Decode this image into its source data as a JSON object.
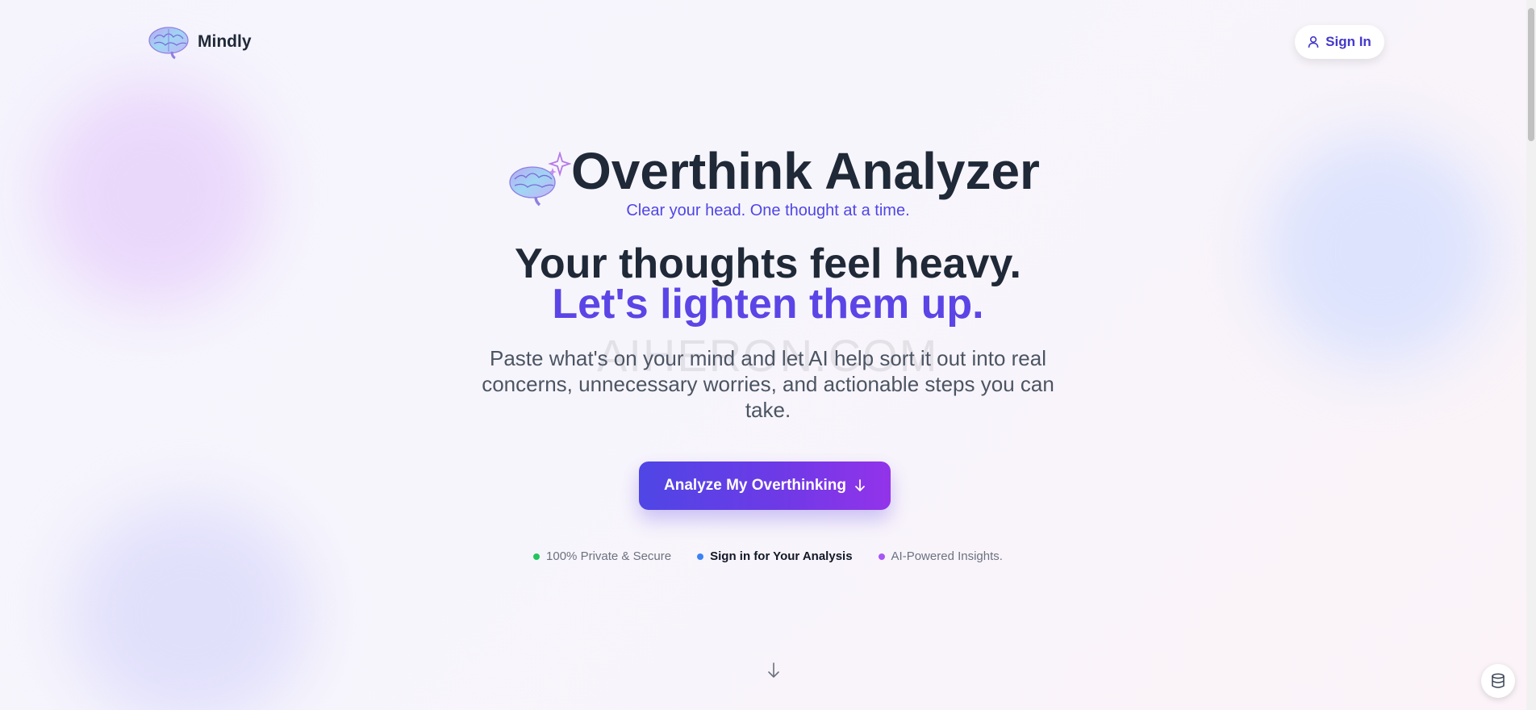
{
  "brand": {
    "name": "Mindly",
    "logo_icon": "brain-icon"
  },
  "header": {
    "signin_label": "Sign In",
    "signin_icon": "user-icon"
  },
  "hero": {
    "title": "Overthink Analyzer",
    "title_icon": "brain-sparkle-icon",
    "tagline": "Clear your head. One thought at a time.",
    "headline_line1": "Your thoughts feel heavy.",
    "headline_line2": "Let's lighten them up.",
    "description": "Paste what's on your mind and let AI help sort it out into real concerns, unnecessary worries, and actionable steps you can take.",
    "cta_label": "Analyze My Overthinking",
    "cta_icon": "arrow-down-icon"
  },
  "watermark": "AIHERON.COM",
  "features": [
    {
      "label": "100% Private & Secure",
      "color": "#22c55e",
      "bold": false
    },
    {
      "label": "Sign in for Your Analysis",
      "color": "#3b82f6",
      "bold": true
    },
    {
      "label": "AI-Powered Insights.",
      "color": "#a855f7",
      "bold": false
    }
  ],
  "colors": {
    "accent": "#4f46e5",
    "accent_light": "#5b45e6",
    "cta_gradient_start": "#4f46e5",
    "cta_gradient_end": "#9333ea",
    "text_dark": "#1f2937",
    "text_muted": "#4b5563"
  }
}
